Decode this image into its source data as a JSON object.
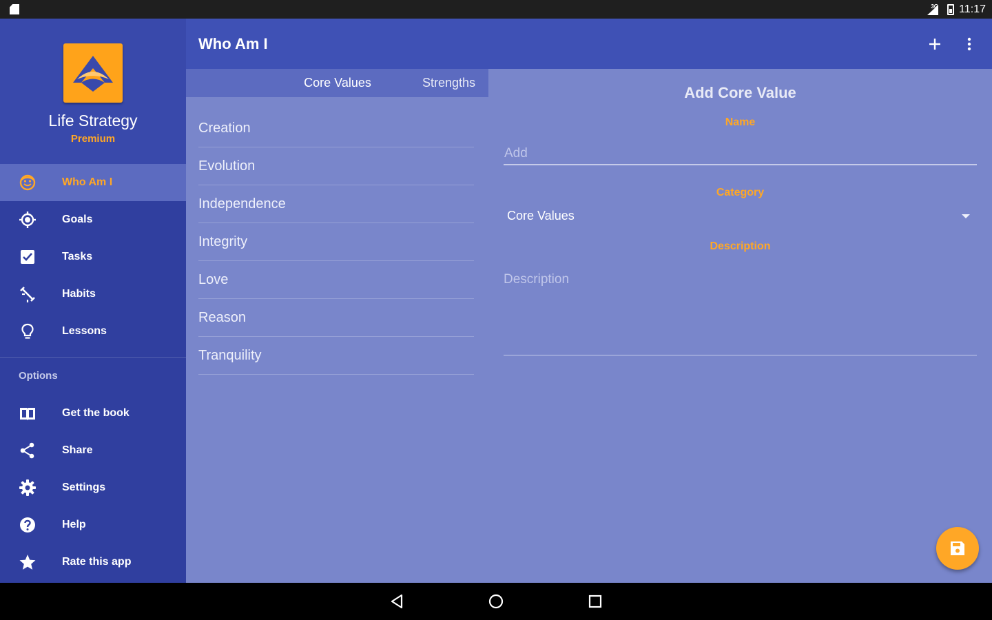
{
  "status_bar": {
    "network": "3G",
    "time": "11:17"
  },
  "app": {
    "name": "Life Strategy",
    "tier": "Premium"
  },
  "nav": {
    "main": [
      {
        "label": "Who Am I",
        "icon": "smiley-icon",
        "active": true
      },
      {
        "label": "Goals",
        "icon": "target-icon"
      },
      {
        "label": "Tasks",
        "icon": "checkbox-icon"
      },
      {
        "label": "Habits",
        "icon": "habits-icon"
      },
      {
        "label": "Lessons",
        "icon": "lightbulb-icon"
      }
    ],
    "options_header": "Options",
    "options": [
      {
        "label": "Get the book",
        "icon": "book-icon"
      },
      {
        "label": "Share",
        "icon": "share-icon"
      },
      {
        "label": "Settings",
        "icon": "gear-icon"
      },
      {
        "label": "Help",
        "icon": "help-icon"
      },
      {
        "label": "Rate this app",
        "icon": "star-icon"
      }
    ]
  },
  "appbar": {
    "title": "Who Am I",
    "add_icon": "plus-icon",
    "more_icon": "more-vert-icon"
  },
  "tabs": [
    {
      "label": "Core Values",
      "active": true
    },
    {
      "label": "Strengths"
    }
  ],
  "core_values": [
    "Creation",
    "Evolution",
    "Independence",
    "Integrity",
    "Love",
    "Reason",
    "Tranquility"
  ],
  "form": {
    "title": "Add Core Value",
    "name_label": "Name",
    "name_placeholder": "Add",
    "category_label": "Category",
    "category_value": "Core Values",
    "description_label": "Description",
    "description_placeholder": "Description",
    "save_icon": "save-icon"
  },
  "colors": {
    "primary": "#3f51b5",
    "sidebar": "#303f9f",
    "accent": "#ffa726",
    "content": "#7986cb"
  }
}
